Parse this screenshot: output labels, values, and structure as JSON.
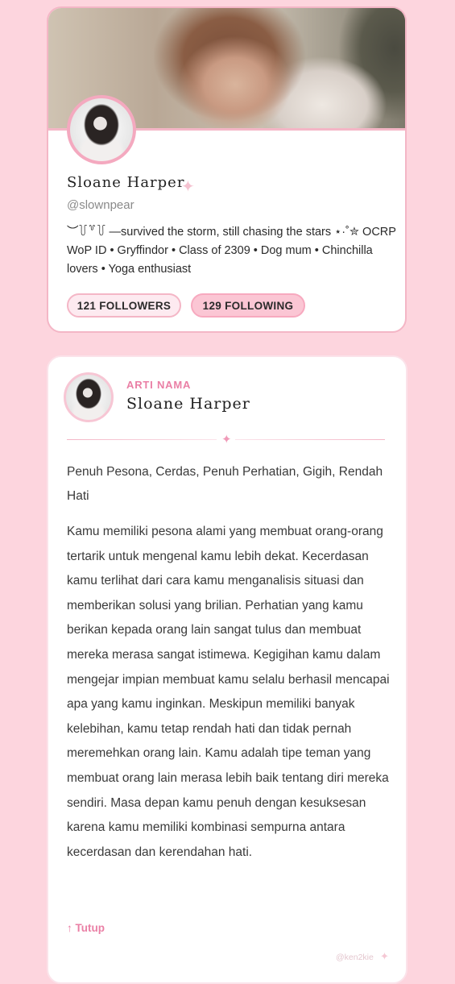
{
  "profile": {
    "name": "Sloane Harper",
    "handle": "@slownpear",
    "bio": "︶꒦꒷꒦ —survived the storm, still chasing the stars ⋆·˚✮ OCRP WoP ID • Gryffindor • Class of 2309 • Dog mum • Chinchilla lovers • Yoga enthusiast",
    "followers_label": "121 FOLLOWERS",
    "following_label": "129 FOLLOWING"
  },
  "meaning": {
    "section_label": "ARTI NAMA",
    "name": "Sloane Harper",
    "traits": "Penuh Pesona, Cerdas, Penuh Perhatian, Gigih, Rendah Hati",
    "description": "Kamu memiliki pesona alami yang membuat orang-orang tertarik untuk mengenal kamu lebih dekat. Kecerdasan kamu terlihat dari cara kamu menganalisis situasi dan memberikan solusi yang brilian. Perhatian yang kamu berikan kepada orang lain sangat tulus dan membuat mereka merasa sangat istimewa. Kegigihan kamu dalam mengejar impian membuat kamu selalu berhasil mencapai apa yang kamu inginkan. Meskipun memiliki banyak kelebihan, kamu tetap rendah hati dan tidak pernah meremehkan orang lain. Kamu adalah tipe teman yang membuat orang lain merasa lebih baik tentang diri mereka sendiri. Masa depan kamu penuh dengan kesuksesan karena kamu memiliki kombinasi sempurna antara kecerdasan dan kerendahan hati.",
    "close_label": "↑ Tutup",
    "watermark": "@ken2kie"
  },
  "icons": {
    "sparkle": "sparkle-icon",
    "close": "arrow-up-icon"
  },
  "colors": {
    "background": "#fdd5de",
    "accent": "#ea7fa5",
    "card_border": "#f4b6c6"
  }
}
